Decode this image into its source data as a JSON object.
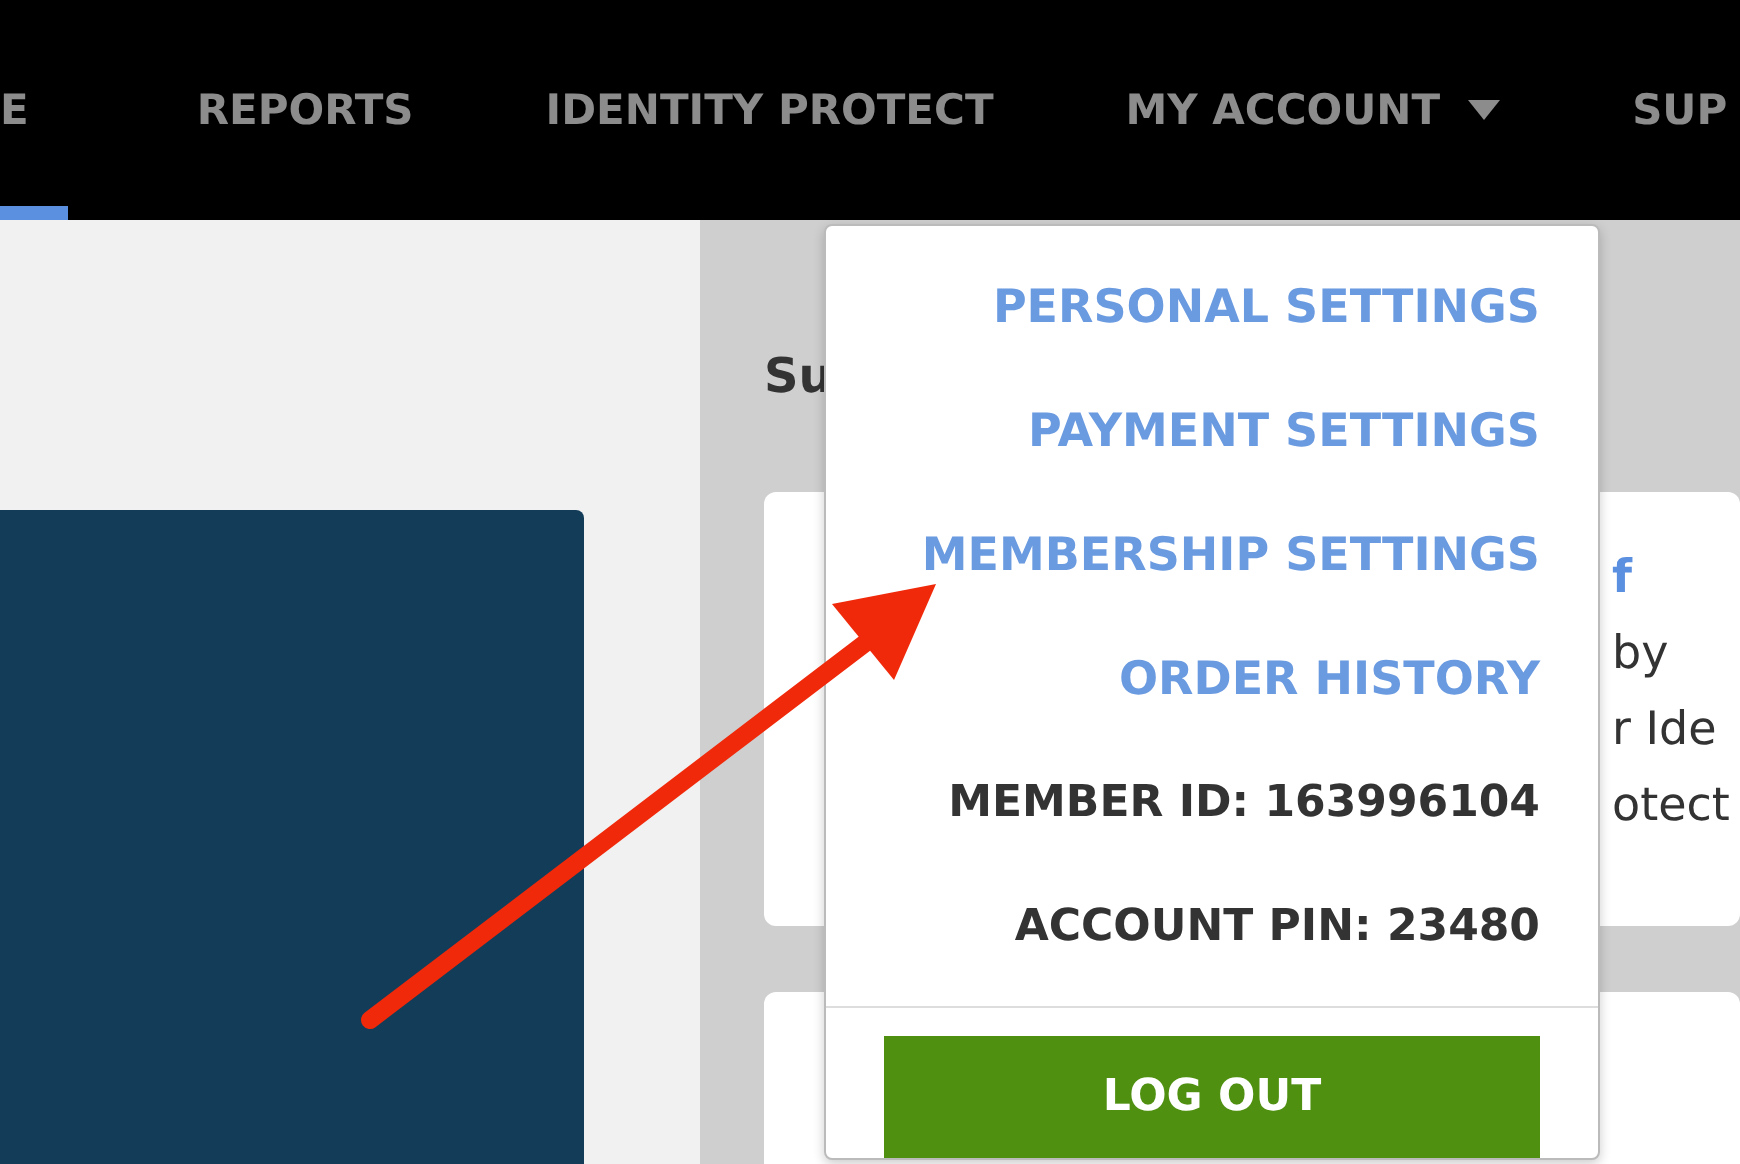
{
  "nav": {
    "items": [
      {
        "label": "E",
        "kind": "link",
        "selected": true
      },
      {
        "label": "REPORTS",
        "kind": "link",
        "selected": false
      },
      {
        "label": "IDENTITY PROTECT",
        "kind": "link",
        "selected": false
      },
      {
        "label": "MY ACCOUNT",
        "kind": "dropdown",
        "selected": false
      },
      {
        "label": "SUP",
        "kind": "link",
        "selected": false
      }
    ]
  },
  "content": {
    "heading": "Su",
    "cards": [
      {
        "lines": [
          {
            "text": "f",
            "kind": "link"
          },
          {
            "text": "by",
            "kind": "text"
          },
          {
            "text": "r Ide",
            "kind": "text"
          },
          {
            "text": "otect",
            "kind": "text"
          }
        ]
      }
    ]
  },
  "account_menu": {
    "links": [
      "PERSONAL SETTINGS",
      "PAYMENT SETTINGS",
      "MEMBERSHIP SETTINGS",
      "ORDER HISTORY"
    ],
    "info": [
      "MEMBER ID: 163996104",
      "ACCOUNT PIN: 23480"
    ],
    "button": "LOG OUT"
  }
}
